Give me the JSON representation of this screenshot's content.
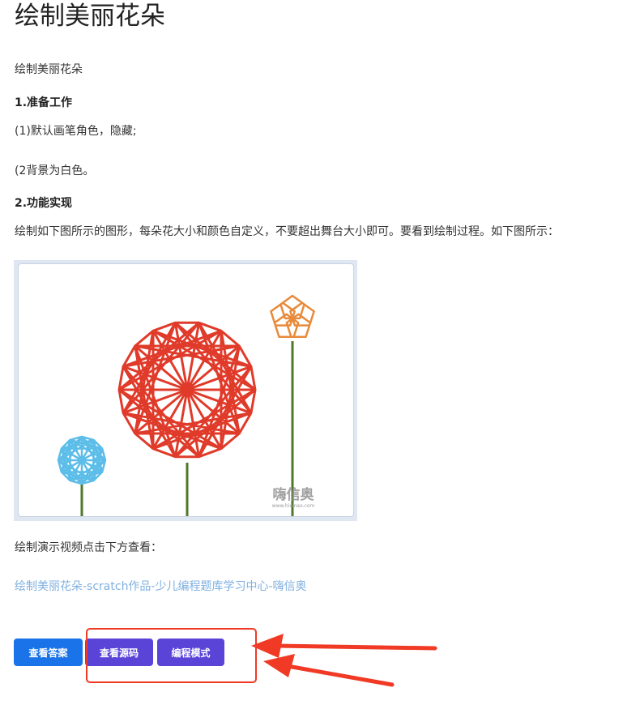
{
  "page": {
    "title": "绘制美丽花朵",
    "intro": "绘制美丽花朵",
    "section1_heading": "1.准备工作",
    "section1_line1": "(1)默认画笔角色，隐藏;",
    "section1_line2": "(2背景为白色。",
    "section2_heading": "2.功能实现",
    "section2_text": "绘制如下图所示的图形，每朵花大小和颜色自定义，不要超出舞台大小即可。要看到绘制过程。如下图所示：",
    "figure_watermark": "嗨信奥",
    "figure_watermark_url": "www.hixinao.com",
    "video_prompt": "绘制演示视频点击下方查看：",
    "video_link": "绘制美丽花朵-scratch作品-少儿编程题库学习中心-嗨信奥"
  },
  "buttons": {
    "answer": "查看答案",
    "source": "查看源码",
    "mode": "编程模式"
  },
  "colors": {
    "flower_large": "#e03b2a",
    "flower_small_right": "#e88a3a",
    "flower_small_left": "#5bbde8",
    "stem": "#4d7a2a",
    "annotation": "#f03a25",
    "button_primary": "#1a73e8",
    "button_secondary": "#5a44d8",
    "link": "#7fb0e0"
  }
}
